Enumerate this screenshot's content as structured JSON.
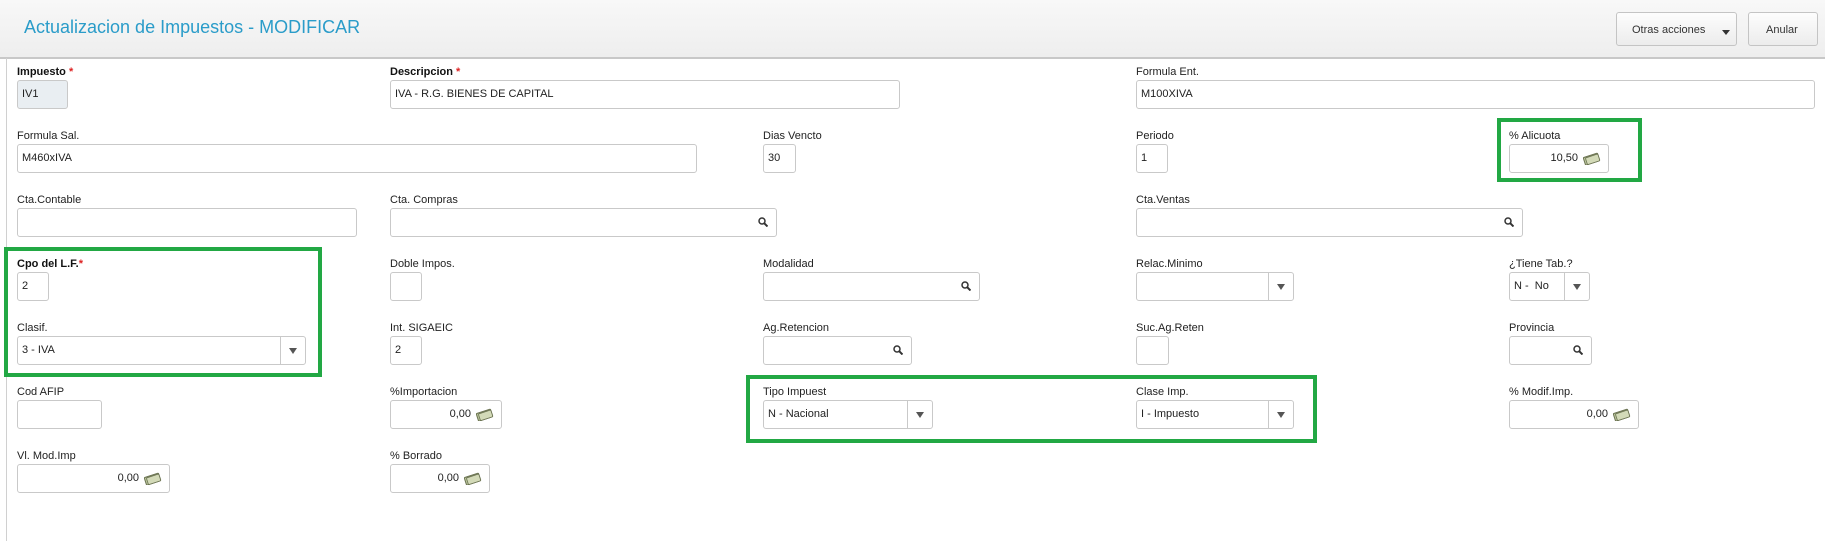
{
  "header": {
    "title": "Actualizacion de Impuestos - MODIFICAR",
    "otras_acciones_label": "Otras acciones",
    "anular_label": "Anular"
  },
  "colors": {
    "accent": "#2a9cc9",
    "highlight": "#22a844",
    "required": "#dd2222"
  },
  "form": {
    "impuesto": {
      "label": "Impuesto",
      "required": "*",
      "value": "IV1"
    },
    "descripcion": {
      "label": "Descripcion",
      "required": "*",
      "value": "IVA - R.G. BIENES DE CAPITAL"
    },
    "formula_ent": {
      "label": "Formula Ent.",
      "value": "M100XIVA"
    },
    "formula_sal": {
      "label": "Formula Sal.",
      "value": "M460xIVA"
    },
    "dias_vencto": {
      "label": "Dias Vencto",
      "value": "30"
    },
    "periodo": {
      "label": "Periodo",
      "value": "1"
    },
    "alicuota": {
      "label": "% Alicuota",
      "value": "10,50"
    },
    "cta_contable": {
      "label": "Cta.Contable",
      "value": ""
    },
    "cta_compras": {
      "label": "Cta. Compras",
      "value": ""
    },
    "cta_ventas": {
      "label": "Cta.Ventas",
      "value": ""
    },
    "cpo_lf": {
      "label": "Cpo del L.F.",
      "required": "*",
      "value": "2"
    },
    "doble_impos": {
      "label": "Doble Impos.",
      "value": ""
    },
    "modalidad": {
      "label": "Modalidad",
      "value": ""
    },
    "relac_minimo": {
      "label": "Relac.Minimo",
      "value": ""
    },
    "tiene_tab": {
      "label": "¿Tiene Tab.?",
      "value": "N -  No"
    },
    "clasif": {
      "label": "Clasif.",
      "value": "3 - IVA"
    },
    "int_sigaeic": {
      "label": "Int. SIGAEIC",
      "value": "2"
    },
    "ag_retencion": {
      "label": "Ag.Retencion",
      "value": ""
    },
    "suc_ag_reten": {
      "label": "Suc.Ag.Reten",
      "value": ""
    },
    "provincia": {
      "label": "Provincia",
      "value": ""
    },
    "cod_afip": {
      "label": "Cod AFIP",
      "value": ""
    },
    "importacion": {
      "label": "%Importacion",
      "value": "0,00"
    },
    "tipo_impuest": {
      "label": "Tipo Impuest",
      "value": "N - Nacional"
    },
    "clase_imp": {
      "label": "Clase Imp.",
      "value": "I - Impuesto"
    },
    "modif_imp": {
      "label": "% Modif.Imp.",
      "value": "0,00"
    },
    "vl_mod_imp": {
      "label": "Vl. Mod.Imp",
      "value": "0,00"
    },
    "borrado": {
      "label": "% Borrado",
      "value": "0,00"
    }
  }
}
